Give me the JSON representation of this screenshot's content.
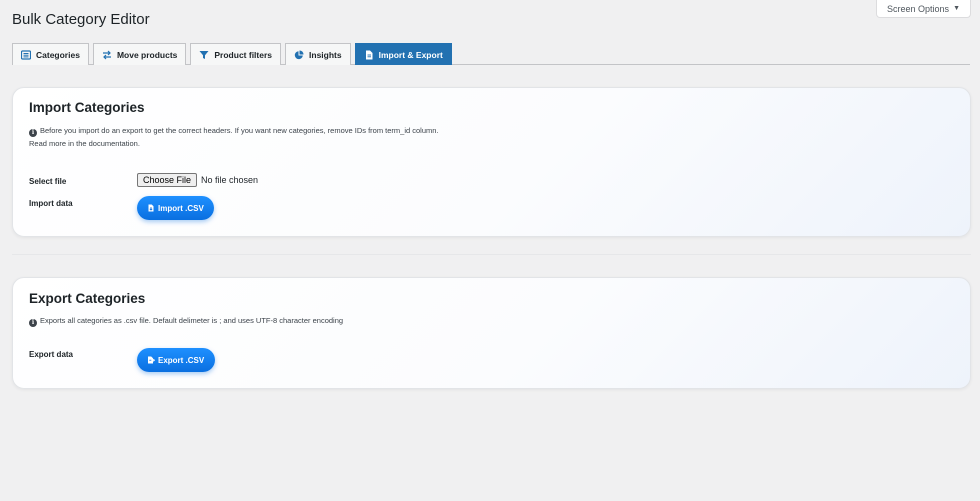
{
  "screen_options": {
    "label": "Screen Options"
  },
  "page": {
    "title": "Bulk Category Editor"
  },
  "tabs": [
    {
      "label": "Categories",
      "icon": "list-icon",
      "active": false
    },
    {
      "label": "Move products",
      "icon": "arrows-swap-icon",
      "active": false
    },
    {
      "label": "Product filters",
      "icon": "filter-icon",
      "active": false
    },
    {
      "label": "Insights",
      "icon": "pie-chart-icon",
      "active": false
    },
    {
      "label": "Import & Export",
      "icon": "document-icon",
      "active": true
    }
  ],
  "import_section": {
    "title": "Import Categories",
    "description_line1": "Before you import do an export to get the correct headers. If you want new categories, remove IDs from term_id column.",
    "description_line2": "Read more in the documentation.",
    "select_file_label": "Select file",
    "choose_file_button": "Choose File",
    "file_status": "No file chosen",
    "import_data_label": "Import data",
    "import_button": "Import .CSV"
  },
  "export_section": {
    "title": "Export Categories",
    "description": "Exports all categories as .csv file. Default delimeter is ; and uses UTF-8 character encoding",
    "export_data_label": "Export data",
    "export_button": "Export .CSV"
  },
  "colors": {
    "accent": "#2271b1",
    "button_blue": "#0a6fe0",
    "background": "#f0f0f1"
  }
}
